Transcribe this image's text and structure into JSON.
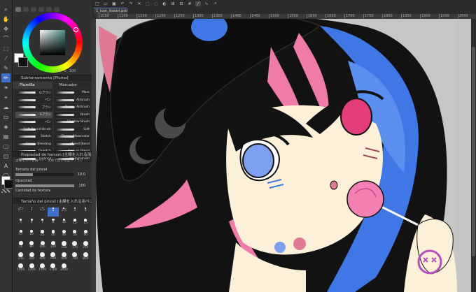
{
  "panel": {
    "hsv_h": "163",
    "hsv_s": "0",
    "hsv_v": "100",
    "brush_panel_title": "Subherramienta [Pluma]",
    "subtabs": [
      "Plumilla",
      "Marcador"
    ],
    "brushes_left": [
      "Gブラシ",
      "ペン",
      "ブラシ",
      "Sブラシ",
      "ペン",
      "Soft Round Brush",
      "Sketch",
      "Floppy Blending",
      "Gsketch",
      "Gpencil"
    ],
    "brushes_right": [
      "Marc",
      "Airbrush",
      "Floppy Airbrush",
      "Brush",
      "Shadow Brush",
      "Soft",
      "Floppy Watercolor",
      "Mixed Blend",
      "Canvas Blend",
      "Round Brush"
    ],
    "tool_property_title": "Propiedad de herram [主線を入れる用ペン...]",
    "tool_property_sub": "主線を入れる用ペン・太めで広がる塗りブラシ",
    "brush_size_label": "Tamaño del pincel",
    "brush_size_value": "10.0",
    "opacity_label": "Opacidad",
    "opacity_value": "100",
    "stabilization_label": "Cantidad de textura",
    "brush_size_panel_title": "Tamaño del pincel [主線を入れる用ペン...]",
    "sizes": [
      "0.7",
      "1",
      "1.5",
      "2",
      "2.5",
      "3",
      "4",
      "5",
      "6",
      "7",
      "8",
      "10",
      "12",
      "15",
      "17",
      "20",
      "25",
      "30",
      "40",
      "50",
      "60",
      "70",
      "80",
      "100",
      "120",
      "150",
      "170",
      "200",
      "250",
      "300",
      "400",
      "500",
      "600",
      "700",
      "800",
      "1000",
      "1200",
      "1500",
      "1700",
      "2000"
    ]
  },
  "document": {
    "tab_label": "1_icon_lineart.psd_b"
  },
  "ruler": [
    "1050",
    "1100",
    "1150",
    "1200",
    "1250",
    "1300",
    "1350",
    "1400",
    "1450",
    "1500",
    "1550",
    "1600",
    "1650",
    "1700",
    "1750",
    "1800",
    "1850",
    "1900",
    "1950",
    "2000"
  ],
  "colors": {
    "accent": "#3f70c8",
    "hair_black": "#121212",
    "hair_pink": "#f07aa8",
    "hair_blue": "#3f78e6",
    "skin": "#fdf0d8",
    "eye_blue": "#7d9ff0",
    "eye_pink": "#e33e7b",
    "lollipop": "#f37fb3",
    "sticker": "#b44fbd"
  }
}
